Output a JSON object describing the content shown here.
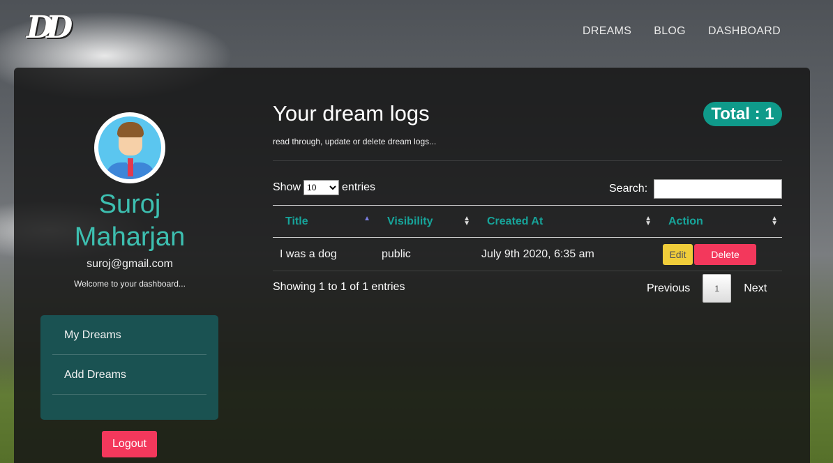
{
  "brand": {
    "logo_text": "DD"
  },
  "nav": {
    "items": [
      "DREAMS",
      "BLOG",
      "DASHBOARD"
    ]
  },
  "profile": {
    "name": "Suroj Maharjan",
    "email": "suroj@gmail.com",
    "welcome": "Welcome to your dashboard..."
  },
  "sidebar": {
    "items": [
      {
        "label": "My Dreams"
      },
      {
        "label": "Add Dreams"
      }
    ]
  },
  "logout_label": "Logout",
  "main": {
    "heading": "Your dream logs",
    "subheading": "read through, update or delete dream logs...",
    "total": "Total : 1"
  },
  "table_controls": {
    "show_label": "Show",
    "entries_label": "entries",
    "page_size": "10",
    "search_label": "Search:",
    "search_value": ""
  },
  "table": {
    "columns": [
      "Title",
      "Visibility",
      "Created At",
      "Action"
    ],
    "rows": [
      {
        "title": "I was a dog",
        "visibility": "public",
        "created_at": "July 9th 2020, 6:35 am",
        "edit_label": "Edit",
        "delete_label": "Delete"
      }
    ]
  },
  "footer": {
    "showing": "Showing 1 to 1 of 1 entries",
    "previous": "Previous",
    "page": "1",
    "next": "Next"
  },
  "colors": {
    "accent": "#17a49a",
    "danger": "#f3385c",
    "warning": "#f0cd3a",
    "badge": "#0f9a8a"
  }
}
